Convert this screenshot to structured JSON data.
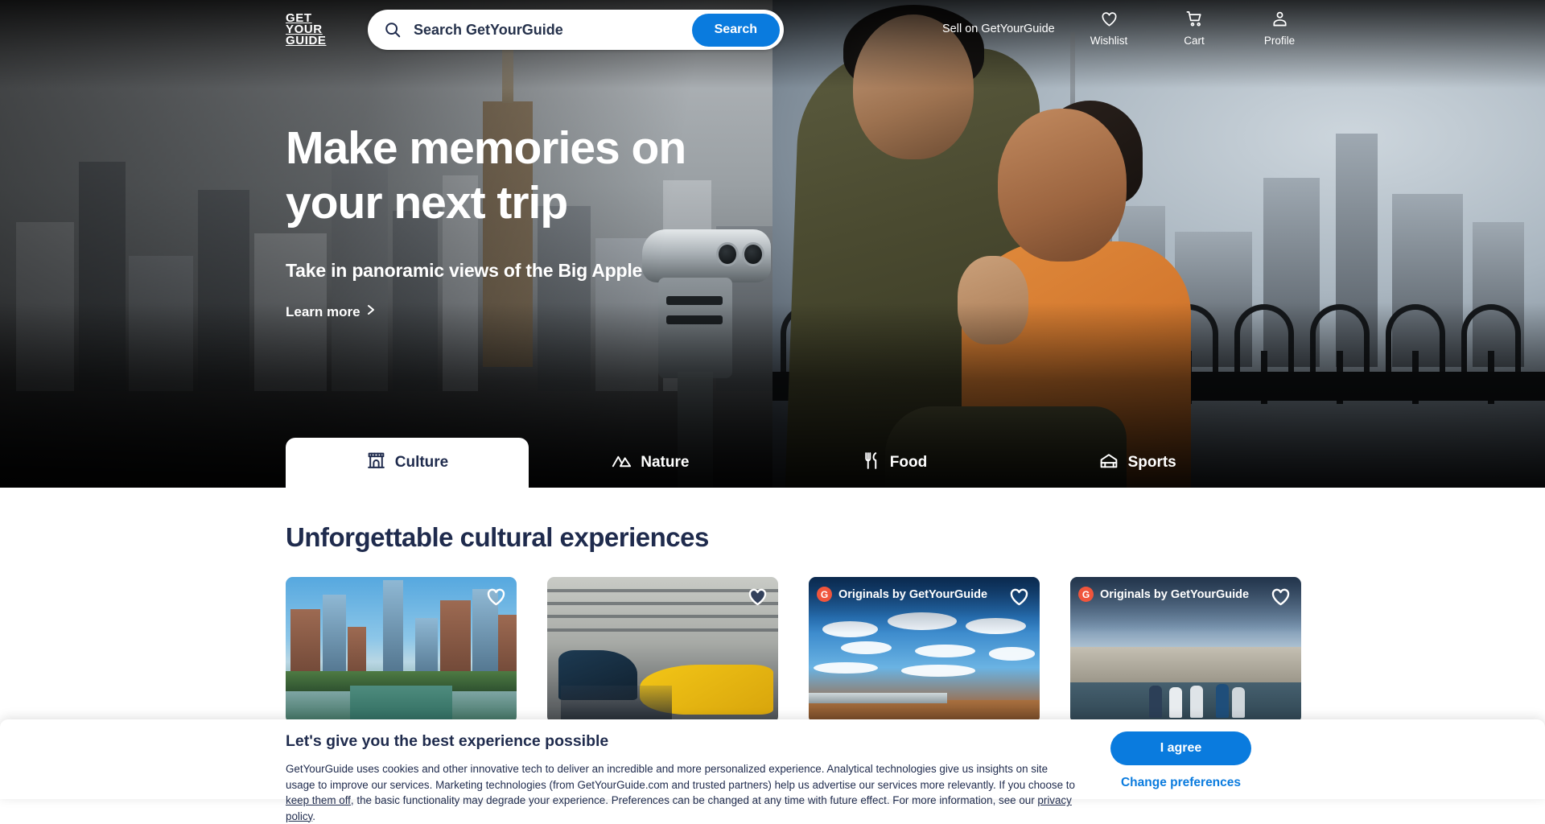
{
  "brand": {
    "logo_line1": "GET",
    "logo_line2": "YOUR",
    "logo_line3": "GUIDE",
    "accent_blue": "#0a7bde",
    "navy": "#1f2b4d",
    "originals_red": "#f0553c"
  },
  "header": {
    "search": {
      "placeholder": "Search GetYourGuide",
      "value": "",
      "button_label": "Search",
      "icon": "search-icon"
    },
    "sell_link": "Sell on GetYourGuide",
    "nav": [
      {
        "label": "Wishlist",
        "icon": "heart-icon"
      },
      {
        "label": "Cart",
        "icon": "cart-icon"
      },
      {
        "label": "Profile",
        "icon": "profile-icon"
      }
    ]
  },
  "hero": {
    "title": "Make memories on your next trip",
    "subtitle": "Take in panoramic views of the Big Apple",
    "learn_more": "Learn more",
    "learn_more_icon": "chevron-right-icon"
  },
  "categories": [
    {
      "label": "Culture",
      "icon": "monument-icon",
      "active": true
    },
    {
      "label": "Nature",
      "icon": "mountain-icon",
      "active": false
    },
    {
      "label": "Food",
      "icon": "fork-knife-icon",
      "active": false
    },
    {
      "label": "Sports",
      "icon": "stadium-icon",
      "active": false
    }
  ],
  "section": {
    "title": "Unforgettable cultural experiences",
    "cards": [
      {
        "alt": "Chicago river skyline city view",
        "originals_badge": null,
        "wishlist_icon": "heart-icon",
        "wishlist_filled": false
      },
      {
        "alt": "Aircraft carrier museum hangar with yellow plane 186",
        "originals_badge": null,
        "wishlist_icon": "heart-icon",
        "wishlist_filled": true
      },
      {
        "alt": "Skywalk viewing platform under blue sky with clouds",
        "originals_badge": "Originals by GetYourGuide",
        "originals_mark": "G",
        "wishlist_icon": "heart-icon",
        "wishlist_filled": false
      },
      {
        "alt": "Group of travellers at the Berlin Wall",
        "originals_badge": "Originals by GetYourGuide",
        "originals_mark": "G",
        "wishlist_icon": "heart-icon",
        "wishlist_filled": false
      }
    ]
  },
  "cookie_banner": {
    "title": "Let's give you the best experience possible",
    "body_part1": "GetYourGuide uses cookies and other innovative tech to deliver an incredible and more personalized experience. Analytical technologies give us insights on site usage to improve our services. Marketing technologies (from GetYourGuide.com and trusted partners) help us advertise our services more relevantly. If you choose to ",
    "keep_them_off_link": "keep them off",
    "body_part2": ", the basic functionality may degrade your experience. Preferences can be changed at any time with future effect. For more information, see our ",
    "privacy_policy_link": "privacy policy",
    "body_part3": ".",
    "agree_label": "I agree",
    "change_preferences_label": "Change preferences"
  }
}
